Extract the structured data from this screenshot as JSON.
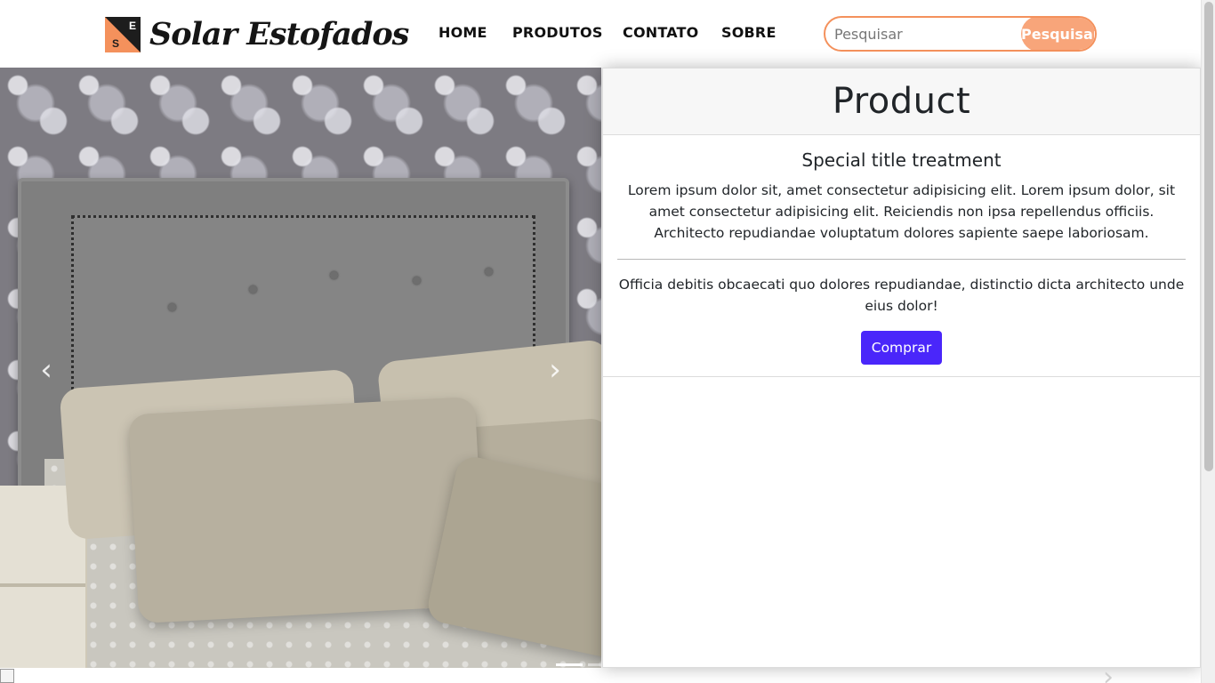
{
  "logo": {
    "badge_letter_top": "E",
    "badge_letter_bottom": "S",
    "text": "Solar Estofados"
  },
  "nav": {
    "items": [
      "HOME",
      "PRODUTOS",
      "CONTATO",
      "SOBRE"
    ]
  },
  "search": {
    "placeholder": "Pesquisar",
    "value": "",
    "button_label": "Pesquisar"
  },
  "carousel": {
    "prev_icon": "chevron-left-icon",
    "next_icon": "chevron-right-icon",
    "prev_glyph": "‹",
    "next_glyph": "›",
    "active_index": 0,
    "slide_count": 2
  },
  "card": {
    "header": "Product",
    "title": "Special title treatment",
    "text": "Lorem ipsum dolor sit, amet consectetur adipisicing elit. Lorem ipsum dolor, sit amet consectetur adipisicing elit. Reiciendis non ipsa repellendus officiis. Architecto repudiandae voluptatum dolores sapiente saepe laboriosam.",
    "text2": "Officia debitis obcaecati quo dolores repudiandae, distinctio dicta architecto unde eius dolor!",
    "button_label": "Comprar"
  },
  "colors": {
    "accent": "#f4915c",
    "search_button": "#f8a57a",
    "buy_button": "#4a26fa"
  }
}
